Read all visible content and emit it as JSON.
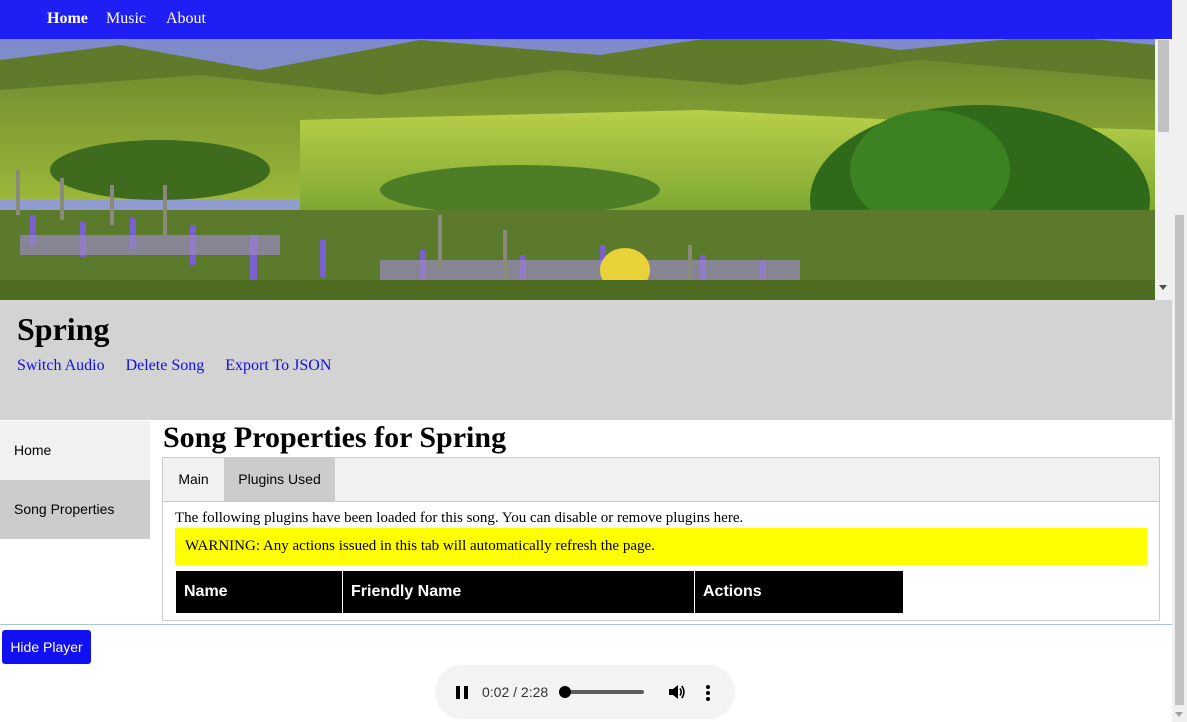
{
  "nav": {
    "items": [
      {
        "label": "Home",
        "active": true
      },
      {
        "label": "Music",
        "active": false
      },
      {
        "label": "About",
        "active": false
      }
    ],
    "color": "#1f1ff5"
  },
  "song": {
    "title": "Spring",
    "actions": [
      "Switch Audio",
      "Delete Song",
      "Export To JSON"
    ]
  },
  "sidebar": {
    "items": [
      {
        "label": "Home"
      },
      {
        "label": "Song Properties"
      }
    ]
  },
  "main": {
    "title": "Song Properties for Spring",
    "tabs": [
      {
        "label": "Main",
        "active": false
      },
      {
        "label": "Plugins Used",
        "active": true
      }
    ],
    "info": "The following plugins have been loaded for this song. You can disable or remove plugins here.",
    "warning": "WARNING: Any actions issued in this tab will automatically refresh the page.",
    "table": {
      "columns": [
        "Name",
        "Friendly Name",
        "Actions"
      ],
      "rows": []
    }
  },
  "player": {
    "hide_label": "Hide Player",
    "current_time": "0:02",
    "duration": "2:28",
    "time_text": "0:02 / 2:28",
    "progress_fraction": 0.0135,
    "state": "playing",
    "icons": [
      "pause-icon",
      "volume-icon",
      "more-options-icon"
    ]
  },
  "hero": {
    "icon": "landscape-photo"
  }
}
